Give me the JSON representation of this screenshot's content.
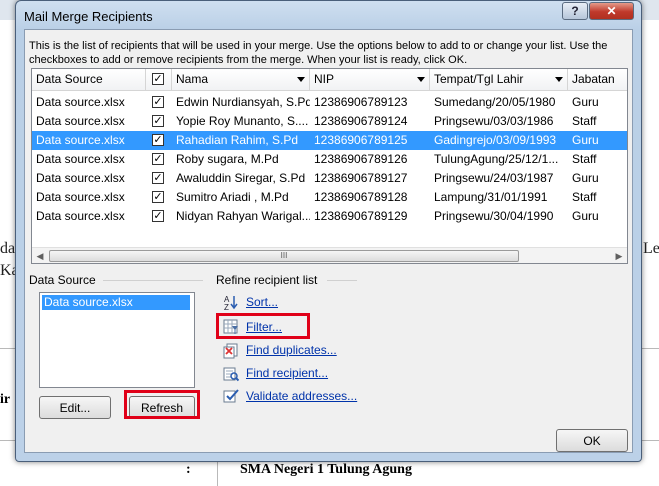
{
  "background": {
    "left_text_1": "da",
    "left_text_2": "Ka",
    "right_text": "Lec",
    "side_bold": "ir",
    "colon": ":",
    "bottom_bold": "SMA Negeri 1 Tulung Agung"
  },
  "dialog": {
    "title": "Mail Merge Recipients",
    "help_label": "?",
    "close_label": "✕",
    "intro": "This is the list of recipients that will be used in your merge.  Use the options below to add to or change your list.  Use the checkboxes to add or remove recipients from the merge.  When your list is ready, click OK.",
    "columns": [
      {
        "label": "Data Source"
      },
      {
        "label": "✓"
      },
      {
        "label": "Nama"
      },
      {
        "label": "NIP"
      },
      {
        "label": "Tempat/Tgl Lahir"
      },
      {
        "label": "Jabatan"
      }
    ],
    "rows": [
      {
        "source": "Data source.xlsx",
        "checked": "✓",
        "nama": "Edwin Nurdiansyah, S.Pd",
        "nip": "12386906789123",
        "ttl": "Sumedang/20/05/1980",
        "jabatan": "Guru"
      },
      {
        "source": "Data source.xlsx",
        "checked": "✓",
        "nama": "Yopie Roy Munanto, S....",
        "nip": "12386906789124",
        "ttl": "Pringsewu/03/03/1986",
        "jabatan": "Staff"
      },
      {
        "source": "Data source.xlsx",
        "checked": "✓",
        "nama": "Rahadian Rahim, S.Pd",
        "nip": "12386906789125",
        "ttl": "Gadingrejo/03/09/1993",
        "jabatan": "Guru"
      },
      {
        "source": "Data source.xlsx",
        "checked": "✓",
        "nama": "Roby sugara, M.Pd",
        "nip": "12386906789126",
        "ttl": "TulungAgung/25/12/1...",
        "jabatan": "Staff"
      },
      {
        "source": "Data source.xlsx",
        "checked": "✓",
        "nama": "Awaluddin Siregar, S.Pd",
        "nip": "12386906789127",
        "ttl": "Pringsewu/24/03/1987",
        "jabatan": "Guru"
      },
      {
        "source": "Data source.xlsx",
        "checked": "✓",
        "nama": "Sumitro Ariadi , M.Pd",
        "nip": "12386906789128",
        "ttl": "Lampung/31/01/1991",
        "jabatan": "Staff"
      },
      {
        "source": "Data source.xlsx",
        "checked": "✓",
        "nama": "Nidyan Rahyan Warigal...",
        "nip": "12386906789129",
        "ttl": "Pringsewu/30/04/1990",
        "jabatan": "Guru"
      }
    ],
    "scroll": {
      "left_arrow": "◀",
      "right_arrow": "▶",
      "grip": "III"
    },
    "data_source_label": "Data Source",
    "data_source_items": [
      "Data source.xlsx"
    ],
    "edit_button": "Edit...",
    "refresh_button": "Refresh",
    "refine_label": "Refine recipient list",
    "refine_links": {
      "sort": "Sort...",
      "filter": "Filter...",
      "find_duplicates": "Find duplicates...",
      "find_recipient": "Find recipient...",
      "validate": "Validate addresses..."
    },
    "ok_button": "OK",
    "highlight_color": "#e00018",
    "selection_color": "#3399ff"
  }
}
